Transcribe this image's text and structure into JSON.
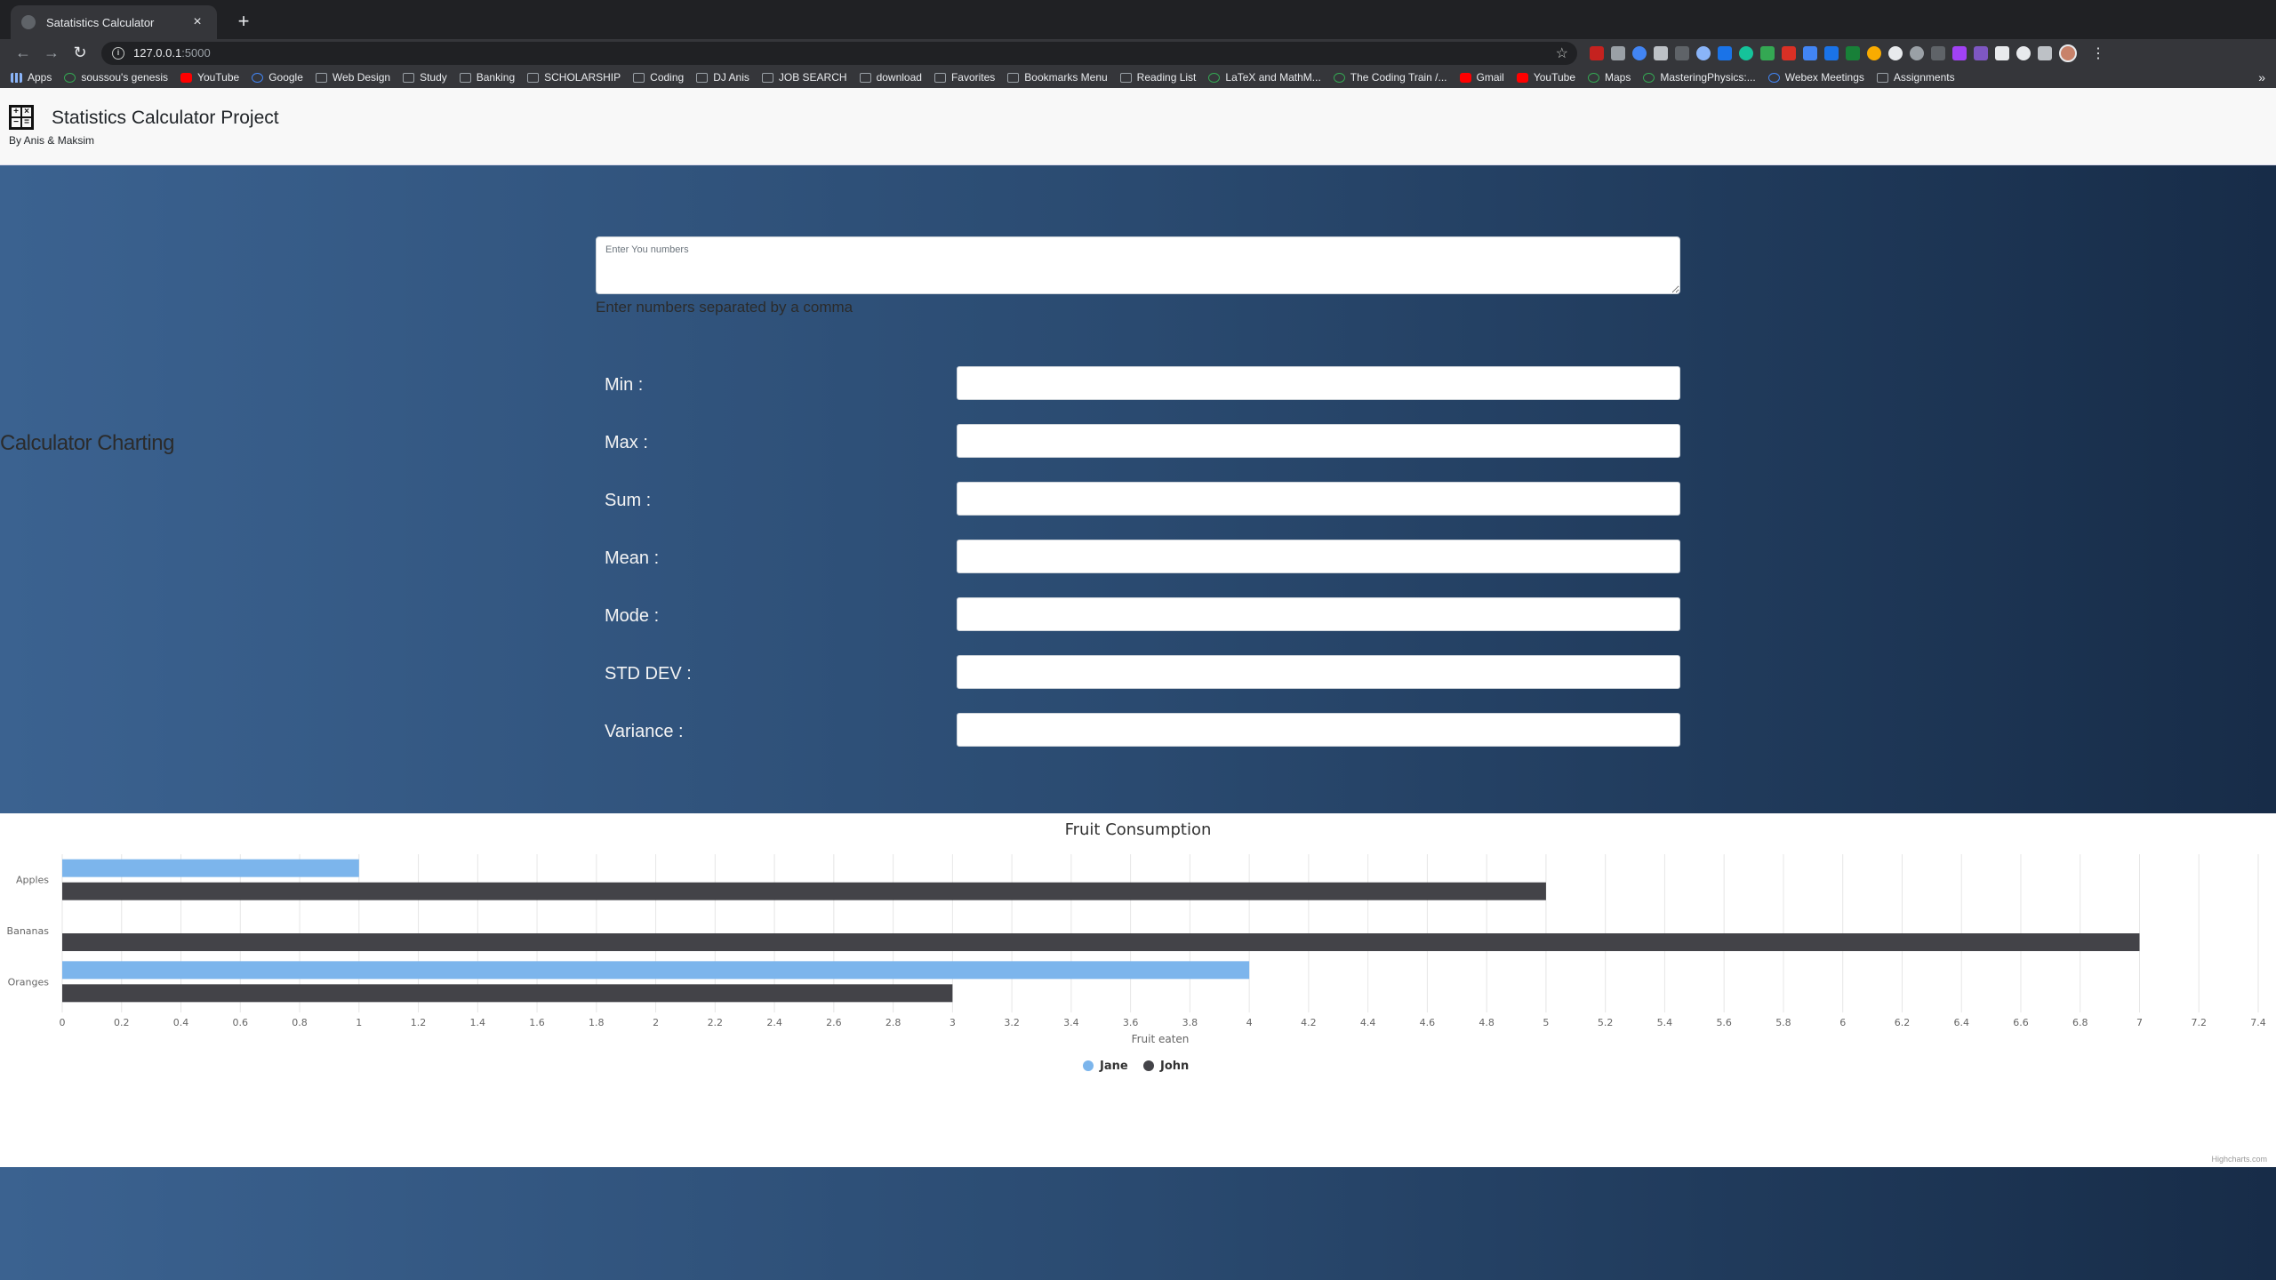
{
  "browser": {
    "tab_title": "Satatistics Calculator",
    "url_host": "127.0.0.1",
    "url_port": ":5000",
    "bookmarks": [
      "Apps",
      "soussou's genesis",
      "YouTube",
      "Google",
      "Web Design",
      "Study",
      "Banking",
      "SCHOLARSHIP",
      "Coding",
      "DJ Anis",
      "JOB SEARCH",
      "download",
      "Favorites",
      "Bookmarks Menu",
      "Reading List",
      "LaTeX and MathM...",
      "The Coding Train /...",
      "Gmail",
      "YouTube",
      "Maps",
      "MasteringPhysics:...",
      "Webex Meetings",
      "Assignments"
    ]
  },
  "header": {
    "title": "Statistics Calculator Project",
    "subtitle": "By Anis & Maksim"
  },
  "hero": {
    "side_title": "Calculator Charting",
    "numbers_placeholder": "Enter You numbers",
    "help_text": "Enter numbers separated by a comma",
    "stats": [
      {
        "label": "Min :",
        "value": ""
      },
      {
        "label": "Max :",
        "value": ""
      },
      {
        "label": "Sum :",
        "value": ""
      },
      {
        "label": "Mean :",
        "value": ""
      },
      {
        "label": "Mode :",
        "value": ""
      },
      {
        "label": "STD DEV :",
        "value": ""
      },
      {
        "label": "Variance :",
        "value": ""
      }
    ]
  },
  "chart_data": {
    "type": "bar",
    "orientation": "horizontal",
    "title": "Fruit Consumption",
    "xlabel": "Fruit eaten",
    "categories": [
      "Apples",
      "Bananas",
      "Oranges"
    ],
    "series": [
      {
        "name": "Jane",
        "color": "#7cb5ec",
        "values": [
          1,
          0,
          4
        ]
      },
      {
        "name": "John",
        "color": "#434348",
        "values": [
          5,
          7,
          3
        ]
      }
    ],
    "xlim": [
      0,
      7.4
    ],
    "tick_step": 0.2,
    "grid": true,
    "legend": "bottom-center",
    "credits": "Highcharts.com"
  }
}
